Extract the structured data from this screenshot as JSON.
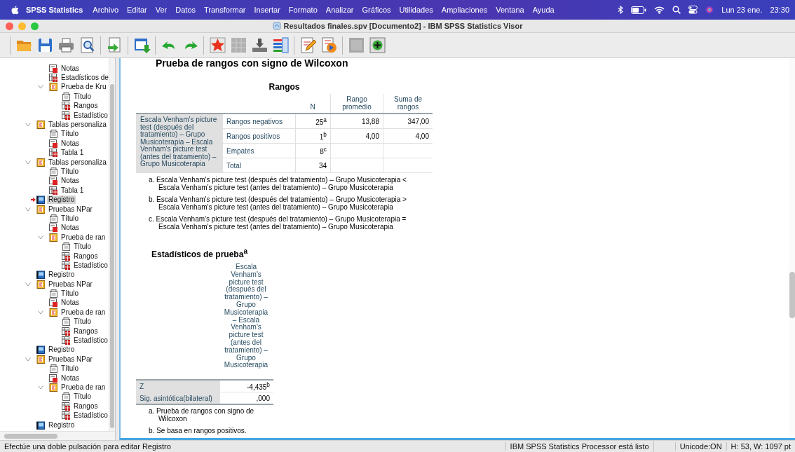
{
  "menubar": {
    "app_name": "SPSS Statistics",
    "menus": [
      "Archivo",
      "Editar",
      "Ver",
      "Datos",
      "Transformar",
      "Insertar",
      "Formato",
      "Analizar",
      "Gráficos",
      "Utilidades",
      "Ampliaciones",
      "Ventana",
      "Ayuda"
    ],
    "date": "Lun 23 ene.",
    "time": "23:30"
  },
  "window": {
    "title": "Resultados finales.spv [Documento2] - IBM SPSS Statistics Visor"
  },
  "toolbar": [
    [
      {
        "kind": "open",
        "disabled": false
      },
      {
        "kind": "save",
        "disabled": false
      },
      {
        "kind": "print",
        "disabled": false
      },
      {
        "kind": "preview",
        "disabled": false
      }
    ],
    [
      {
        "kind": "export",
        "disabled": false
      }
    ],
    [
      {
        "kind": "goto_data",
        "disabled": false
      }
    ],
    [
      {
        "kind": "undo",
        "disabled": false
      },
      {
        "kind": "redo",
        "disabled": false
      }
    ],
    [
      {
        "kind": "star",
        "disabled": false
      },
      {
        "kind": "grid",
        "disabled": true
      },
      {
        "kind": "bar_arrow",
        "disabled": false
      },
      {
        "kind": "list",
        "disabled": false
      }
    ],
    [
      {
        "kind": "edit",
        "disabled": false
      },
      {
        "kind": "forward",
        "disabled": false
      }
    ],
    [
      {
        "kind": "square",
        "disabled": true
      },
      {
        "kind": "add",
        "disabled": false
      }
    ]
  ],
  "outline": [
    {
      "children": [
        {
          "label": "Notas",
          "kind": "notes",
          "selected": false
        },
        {
          "label": "Estadísticos de",
          "kind": "table",
          "selected": false
        },
        {
          "label": "Prueba de Kru",
          "kind": "group",
          "selected": false,
          "expanded": true,
          "children": [
            {
              "label": "Título",
              "kind": "title",
              "selected": false
            },
            {
              "label": "Rangos",
              "kind": "table",
              "selected": false
            },
            {
              "label": "Estadístico",
              "kind": "table",
              "selected": false
            }
          ]
        }
      ]
    },
    {
      "label": "Tablas personaliza",
      "kind": "group",
      "selected": false,
      "expanded": true,
      "children": [
        {
          "label": "Título",
          "kind": "title",
          "selected": false
        },
        {
          "label": "Notas",
          "kind": "notes",
          "selected": false
        },
        {
          "label": "Tabla 1",
          "kind": "table",
          "selected": false
        }
      ]
    },
    {
      "label": "Tablas personaliza",
      "kind": "group",
      "selected": false,
      "expanded": true,
      "children": [
        {
          "label": "Título",
          "kind": "title",
          "selected": false
        },
        {
          "label": "Notas",
          "kind": "notes",
          "selected": false
        },
        {
          "label": "Tabla 1",
          "kind": "table",
          "selected": false
        }
      ]
    },
    {
      "label": "Registro",
      "kind": "log",
      "selected": true
    },
    {
      "label": "Pruebas NPar",
      "kind": "group",
      "selected": false,
      "expanded": true,
      "children": [
        {
          "label": "Título",
          "kind": "title",
          "selected": false
        },
        {
          "label": "Notas",
          "kind": "notes",
          "selected": false
        },
        {
          "label": "Prueba de ran",
          "kind": "group",
          "selected": false,
          "expanded": true,
          "children": [
            {
              "label": "Título",
              "kind": "title",
              "selected": false
            },
            {
              "label": "Rangos",
              "kind": "table",
              "selected": false
            },
            {
              "label": "Estadístico",
              "kind": "table",
              "selected": false
            }
          ]
        }
      ]
    },
    {
      "label": "Registro",
      "kind": "log",
      "selected": false
    },
    {
      "label": "Pruebas NPar",
      "kind": "group",
      "selected": false,
      "expanded": true,
      "children": [
        {
          "label": "Título",
          "kind": "title",
          "selected": false
        },
        {
          "label": "Notas",
          "kind": "notes",
          "selected": false
        },
        {
          "label": "Prueba de ran",
          "kind": "group",
          "selected": false,
          "expanded": true,
          "children": [
            {
              "label": "Título",
              "kind": "title",
              "selected": false
            },
            {
              "label": "Rangos",
              "kind": "table",
              "selected": false
            },
            {
              "label": "Estadístico",
              "kind": "table",
              "selected": false
            }
          ]
        }
      ]
    },
    {
      "label": "Registro",
      "kind": "log",
      "selected": false
    },
    {
      "label": "Pruebas NPar",
      "kind": "group",
      "selected": false,
      "expanded": true,
      "children": [
        {
          "label": "Título",
          "kind": "title",
          "selected": false
        },
        {
          "label": "Notas",
          "kind": "notes",
          "selected": false
        },
        {
          "label": "Prueba de ran",
          "kind": "group",
          "selected": false,
          "expanded": true,
          "children": [
            {
              "label": "Título",
              "kind": "title",
              "selected": false
            },
            {
              "label": "Rangos",
              "kind": "table",
              "selected": false
            },
            {
              "label": "Estadístico",
              "kind": "table",
              "selected": false
            }
          ]
        }
      ]
    },
    {
      "label": "Registro",
      "kind": "log",
      "selected": false
    }
  ],
  "output": {
    "heading": "Prueba de rangos con signo de Wilcoxon",
    "ranks_table": {
      "title": "Rangos",
      "columns": [
        "N",
        "Rango promedio",
        "Suma de rangos"
      ],
      "row_label": "Escala Venham's picture test (después del tratamiento) – Grupo Musicoterapia – Escala Venham's picture test (antes del tratamiento) – Grupo Musicoterapia",
      "rows": [
        {
          "label": "Rangos negativos",
          "cells": [
            "25$^{a}$",
            "13,88",
            "347,00"
          ]
        },
        {
          "label": "Rangos positivos",
          "cells": [
            "1$^{b}$",
            "4,00",
            "4,00"
          ]
        },
        {
          "label": "Empates",
          "cells": [
            "8$^{c}$",
            "",
            ""
          ]
        },
        {
          "label": "Total",
          "cells": [
            "34",
            "",
            ""
          ]
        }
      ],
      "footnotes": [
        "a. Escala Venham's picture test (después del tratamiento) – Grupo Musicoterapia < Escala Venham's picture test (antes del tratamiento) – Grupo Musicoterapia",
        "b. Escala Venham's picture test (después del tratamiento) – Grupo Musicoterapia > Escala Venham's picture test (antes del tratamiento) – Grupo Musicoterapia",
        "c. Escala Venham's picture test (después del tratamiento) – Grupo Musicoterapia = Escala Venham's picture test (antes del tratamiento) – Grupo Musicoterapia"
      ]
    },
    "stats_table": {
      "title": "Estadísticos de prueba$^{a}$",
      "column": "Escala Venham's picture test (después del tratamiento) – Grupo Musicoterapia – Escala Venham's picture test (antes del tratamiento) – Grupo Musicoterapia",
      "rows": [
        {
          "label": "Z",
          "value": "-4,435$^{b}$"
        },
        {
          "label": "Sig. asintótica(bilateral)",
          "value": ",000"
        }
      ],
      "footnotes": [
        "a. Prueba de rangos con signo de Wilcoxon",
        "b. Se basa en rangos positivos."
      ]
    }
  },
  "status_bar": {
    "message": "Efectúe una doble pulsación para editar Registro",
    "processor": "IBM SPSS Statistics Processor está listo",
    "unicode": "Unicode:ON",
    "size": "H: 53, W: 1097 pt"
  }
}
